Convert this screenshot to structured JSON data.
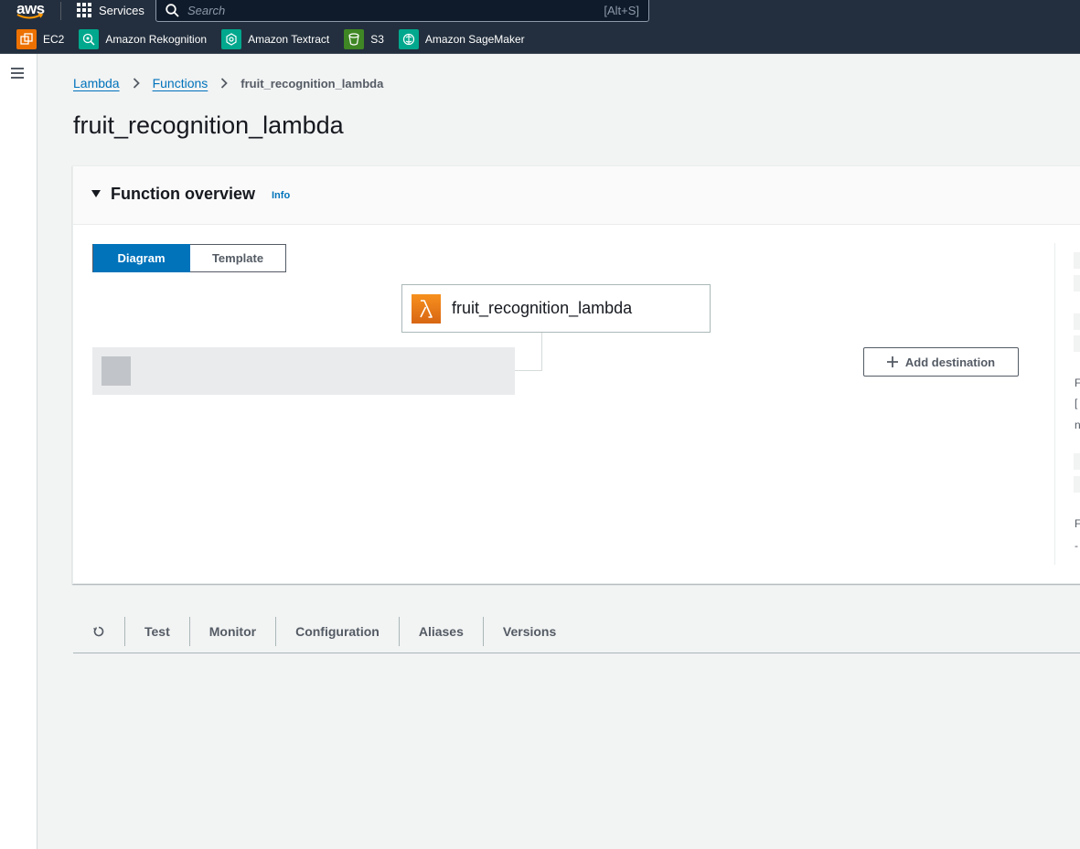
{
  "topnav": {
    "logo": "aws",
    "services_label": "Services",
    "search_placeholder": "Search",
    "search_shortcut": "[Alt+S]"
  },
  "favorites": [
    {
      "label": "EC2",
      "icon": "ec2-icon",
      "color": "#ed7100"
    },
    {
      "label": "Amazon Rekognition",
      "icon": "rekognition-icon",
      "color": "#01a88d"
    },
    {
      "label": "Amazon Textract",
      "icon": "textract-icon",
      "color": "#01a88d"
    },
    {
      "label": "S3",
      "icon": "s3-icon",
      "color": "#3f8624"
    },
    {
      "label": "Amazon SageMaker",
      "icon": "sagemaker-icon",
      "color": "#01a88d"
    }
  ],
  "breadcrumb": [
    "Lambda",
    "Functions",
    "fruit_recognition_lambda"
  ],
  "page_title": "fruit_recognition_lambda",
  "overview": {
    "title": "Function overview",
    "info": "Info",
    "segments": [
      "Diagram",
      "Template"
    ],
    "selected_segment": "Diagram",
    "function_name": "fruit_recognition_lambda",
    "add_destination": "Add destination",
    "side_snippets": [
      "F",
      "[",
      "n",
      "F",
      "-"
    ]
  },
  "tabs": [
    "Test",
    "Monitor",
    "Configuration",
    "Aliases",
    "Versions"
  ],
  "colors": {
    "nav_bg": "#232f3e",
    "accent": "#0073bb",
    "lambda_orange": "#ed7100"
  }
}
